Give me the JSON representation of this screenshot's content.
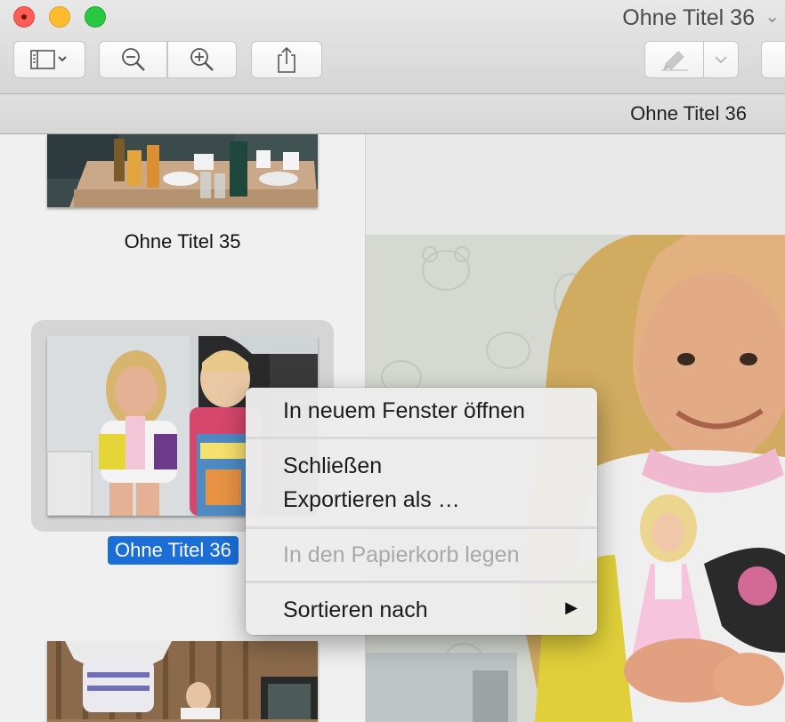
{
  "window": {
    "title": "Ohne Titel 36",
    "path_title": "Ohne Titel 36"
  },
  "toolbar": {
    "buttons": [
      {
        "name": "sidebar-toggle",
        "icon": "sidebar-icon"
      },
      {
        "name": "zoom-out",
        "icon": "zoom-out-icon"
      },
      {
        "name": "zoom-in",
        "icon": "zoom-in-icon"
      },
      {
        "name": "share",
        "icon": "share-icon"
      },
      {
        "name": "markup",
        "icon": "pen-icon"
      }
    ]
  },
  "sidebar": {
    "items": [
      {
        "label": "Ohne Titel 35",
        "selected": false
      },
      {
        "label": "Ohne Titel 36",
        "selected": true
      },
      {
        "label": "",
        "selected": false
      }
    ]
  },
  "context_menu": {
    "items": [
      {
        "label": "In neuem Fenster öffnen",
        "enabled": true
      },
      {
        "label": "Schließen",
        "enabled": true
      },
      {
        "label": "Exportieren als …",
        "enabled": true
      },
      {
        "label": "In den Papierkorb legen",
        "enabled": false
      },
      {
        "label": "Sortieren nach",
        "enabled": true,
        "submenu": true
      }
    ]
  },
  "colors": {
    "selection": "#1a6ed6",
    "close": "#fc5f57",
    "minimize": "#fdbc2e",
    "maximize": "#2ac840"
  }
}
